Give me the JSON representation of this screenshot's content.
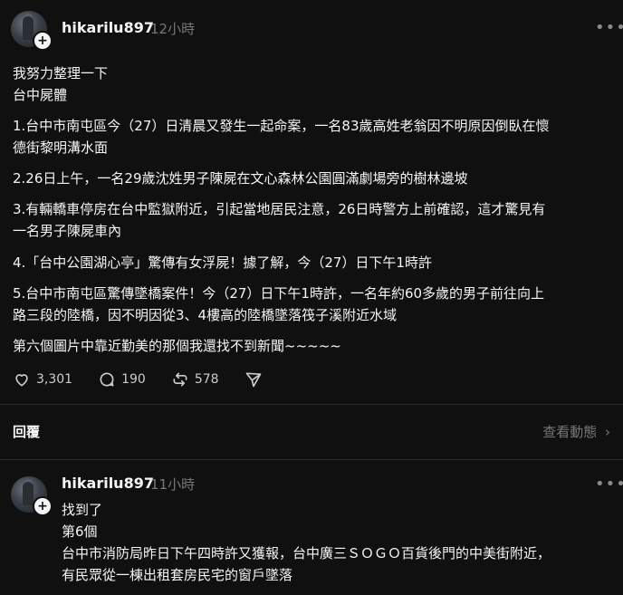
{
  "post": {
    "username": "hikarilu897",
    "time": "12小時",
    "lines": [
      "我努力整理一下",
      "台中屍體",
      "1.台中市南屯區今（27）日清晨又發生一起命案，一名83歲高姓老翁因不明原因倒臥在懷",
      "德街黎明溝水面",
      "2.26日上午，一名29歲沈姓男子陳屍在文心森林公園圓滿劇場旁的樹林邊坡",
      "3.有輛轎車停房在台中監獄附近，引起當地居民注意，26日時警方上前確認，這才驚見有",
      "一名男子陳屍車內",
      "4.「台中公園湖心亭」驚傳有女浮屍！據了解，今（27）日下午1時許",
      "5.台中市南屯區驚傳墜橋案件！今（27）日下午1時許，一名年約60多歲的男子前往向上",
      "路三段的陸橋，因不明因從3、4樓高的陸橋墜落筏子溪附近水域",
      "第六個圖片中靠近勤美的那個我還找不到新聞~~~~~"
    ],
    "likes": "3,301",
    "comments": "190",
    "reposts": "578"
  },
  "replies_bar": {
    "label": "回覆",
    "view_activity": "查看動態"
  },
  "reply": {
    "username": "hikarilu897",
    "time": "11小時",
    "lines": [
      "找到了",
      "第6個",
      "台中市消防局昨日下午四時許又獲報，台中廣三ＳＯＧＯ百貨後門的中美街附近，",
      "有民眾從一棟出租套房民宅的窗戶墜落"
    ]
  },
  "icons": {
    "more": "more-horizontal-icon",
    "like": "heart-icon",
    "comment": "comment-bubble-icon",
    "repost": "repost-icon",
    "share": "send-icon",
    "chevron": "chevron-right-icon",
    "follow": "plus-icon"
  },
  "colors": {
    "background": "#101010",
    "text": "#f3f5f7",
    "muted": "#777777",
    "divider": "#2d2d2d"
  }
}
